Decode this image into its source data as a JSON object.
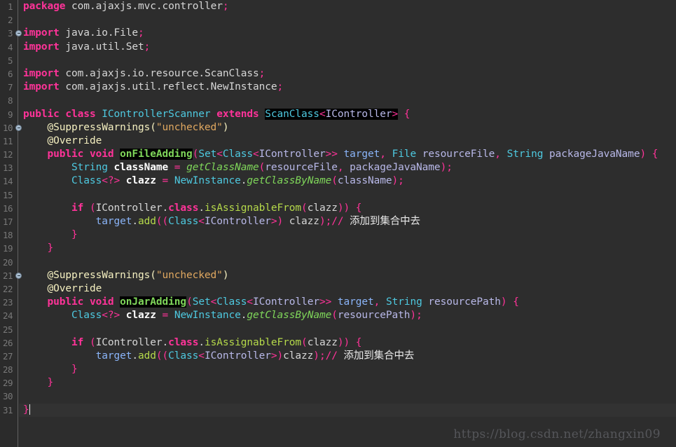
{
  "editor": {
    "language": "Java",
    "theme_colors": {
      "background": "#2d2d2d",
      "gutter_background": "#2b2b2b",
      "gutter_separator": "#616161",
      "line_number": "#787878",
      "current_line_highlight": "#323232",
      "keyword": "#ff3399",
      "type": "#4ec9e0",
      "variable": "#ffffff",
      "parameter": "#b8b8e8",
      "field": "#8ab4f8",
      "method_italic": "#7fd65a",
      "method": "#b5d94a",
      "annotation": "#f5f0c0",
      "string": "#e0a860",
      "comment": "#e8e8e8",
      "selection_background": "#000000",
      "default_text": "#d6d6d6"
    },
    "total_lines": 31,
    "cursor_line": 31,
    "fold_marker_lines": [
      3,
      10,
      21
    ],
    "line_numbers": [
      1,
      2,
      3,
      4,
      5,
      6,
      7,
      8,
      9,
      10,
      11,
      12,
      13,
      14,
      15,
      16,
      17,
      18,
      19,
      20,
      21,
      22,
      23,
      24,
      25,
      26,
      27,
      28,
      29,
      30,
      31
    ],
    "lines": [
      {
        "n": 1,
        "text": "package com.ajaxjs.mvc.controller;"
      },
      {
        "n": 2,
        "text": ""
      },
      {
        "n": 3,
        "text": "import java.io.File;"
      },
      {
        "n": 4,
        "text": "import java.util.Set;"
      },
      {
        "n": 5,
        "text": ""
      },
      {
        "n": 6,
        "text": "import com.ajaxjs.io.resource.ScanClass;"
      },
      {
        "n": 7,
        "text": "import com.ajaxjs.util.reflect.NewInstance;"
      },
      {
        "n": 8,
        "text": ""
      },
      {
        "n": 9,
        "text": "public class IControllerScanner extends ScanClass<IController> {"
      },
      {
        "n": 10,
        "text": "    @SuppressWarnings(\"unchecked\")"
      },
      {
        "n": 11,
        "text": "    @Override"
      },
      {
        "n": 12,
        "text": "    public void onFileAdding(Set<Class<IController>> target, File resourceFile, String packageJavaName) {"
      },
      {
        "n": 13,
        "text": "        String className = getClassName(resourceFile, packageJavaName);"
      },
      {
        "n": 14,
        "text": "        Class<?> clazz = NewInstance.getClassByName(className);"
      },
      {
        "n": 15,
        "text": ""
      },
      {
        "n": 16,
        "text": "        if (IController.class.isAssignableFrom(clazz)) {"
      },
      {
        "n": 17,
        "text": "            target.add((Class<IController>) clazz);// 添加到集合中去"
      },
      {
        "n": 18,
        "text": "        }"
      },
      {
        "n": 19,
        "text": "    }"
      },
      {
        "n": 20,
        "text": ""
      },
      {
        "n": 21,
        "text": "    @SuppressWarnings(\"unchecked\")"
      },
      {
        "n": 22,
        "text": "    @Override"
      },
      {
        "n": 23,
        "text": "    public void onJarAdding(Set<Class<IController>> target, String resourcePath) {"
      },
      {
        "n": 24,
        "text": "        Class<?> clazz = NewInstance.getClassByName(resourcePath);"
      },
      {
        "n": 25,
        "text": ""
      },
      {
        "n": 26,
        "text": "        if (IController.class.isAssignableFrom(clazz)) {"
      },
      {
        "n": 27,
        "text": "            target.add((Class<IController>)clazz);// 添加到集合中去"
      },
      {
        "n": 28,
        "text": "        }"
      },
      {
        "n": 29,
        "text": "    }"
      },
      {
        "n": 30,
        "text": ""
      },
      {
        "n": 31,
        "text": "}"
      }
    ],
    "selections": [
      {
        "line": 9,
        "text": "ScanClass<IController>"
      },
      {
        "line": 12,
        "text": "onFileAdding"
      },
      {
        "line": 23,
        "text": "onJarAdding"
      }
    ],
    "comments": [
      {
        "line": 17,
        "marker": "//",
        "text": "添加到集合中去"
      },
      {
        "line": 27,
        "marker": "//",
        "text": "添加到集合中去"
      }
    ]
  },
  "watermark": {
    "text": "https://blog.csdn.net/zhangxin09"
  }
}
